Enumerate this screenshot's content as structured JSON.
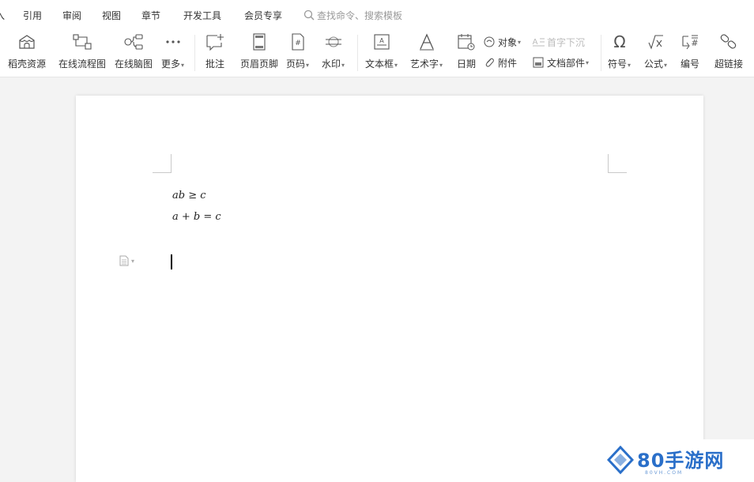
{
  "menu": {
    "tabs": [
      {
        "label": "插入",
        "partial": "入"
      },
      {
        "label": "引用"
      },
      {
        "label": "审阅"
      },
      {
        "label": "视图"
      },
      {
        "label": "章节"
      },
      {
        "label": "开发工具"
      },
      {
        "label": "会员专享"
      }
    ],
    "search_placeholder": "查找命令、搜索模板"
  },
  "ribbon": {
    "docer": "稻壳资源",
    "flowchart": "在线流程图",
    "mindmap": "在线脑图",
    "more": "更多",
    "comment": "批注",
    "header_footer": "页眉页脚",
    "page_number": "页码",
    "watermark": "水印",
    "textbox": "文本框",
    "wordart": "艺术字",
    "date": "日期",
    "object": "对象",
    "dropcap": "首字下沉",
    "attachment": "附件",
    "doc_parts": "文档部件",
    "symbol": "符号",
    "formula": "公式",
    "numbering": "编号",
    "hyperlink": "超链接"
  },
  "document": {
    "equation1": "ab ≥ c",
    "equation2": "a + b = c"
  },
  "watermark": {
    "brand": "80手游网",
    "sub": "80VH.COM"
  },
  "colors": {
    "accent": "#2a6fc9",
    "background": "#f3f3f3"
  }
}
